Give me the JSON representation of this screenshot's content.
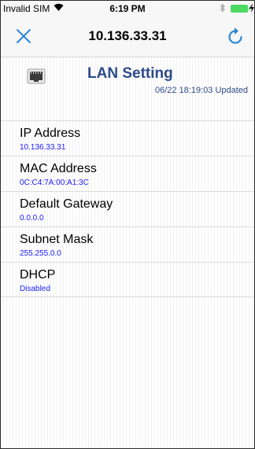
{
  "status_bar": {
    "carrier": "Invalid SIM",
    "time": "6:19 PM",
    "battery_color": "#4cd964"
  },
  "nav": {
    "title": "10.136.33.31",
    "close_icon": "close-icon",
    "refresh_icon": "refresh-icon",
    "accent_color": "#2e86d6"
  },
  "header": {
    "title": "LAN Setting",
    "updated": "06/22 18:19:03 Updated",
    "icon": "ethernet-port-icon"
  },
  "settings": [
    {
      "label": "IP Address",
      "value": "10.136.33.31"
    },
    {
      "label": "MAC Address",
      "value": "0C:C4:7A:00:A1:3C"
    },
    {
      "label": "Default Gateway",
      "value": "0.0.0.0"
    },
    {
      "label": "Subnet Mask",
      "value": "255.255.0.0"
    },
    {
      "label": "DHCP",
      "value": "Disabled"
    }
  ]
}
